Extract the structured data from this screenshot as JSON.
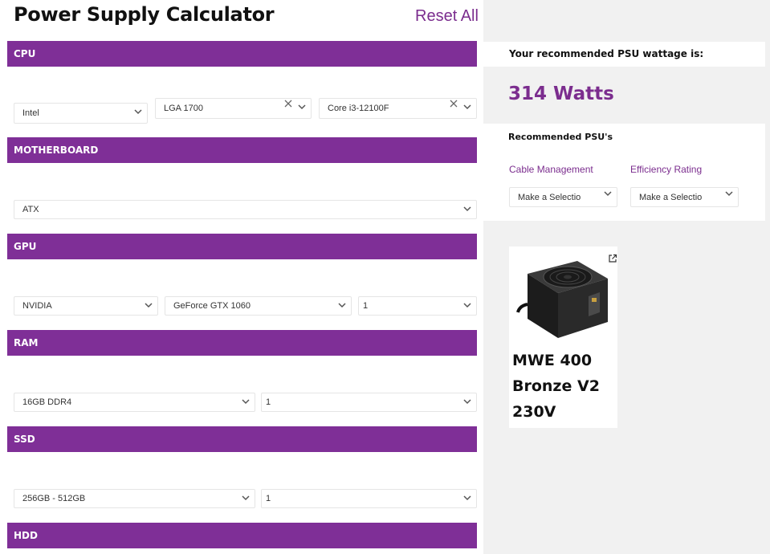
{
  "header": {
    "title": "Power Supply Calculator",
    "reset_label": "Reset All"
  },
  "sections": {
    "cpu": {
      "label": "CPU",
      "brand": "Intel",
      "socket": "LGA 1700",
      "model": "Core i3-12100F"
    },
    "motherboard": {
      "label": "MOTHERBOARD",
      "form_factor": "ATX"
    },
    "gpu": {
      "label": "GPU",
      "brand": "NVIDIA",
      "model": "GeForce GTX 1060",
      "quantity": "1"
    },
    "ram": {
      "label": "RAM",
      "size": "16GB DDR4",
      "quantity": "1"
    },
    "ssd": {
      "label": "SSD",
      "size": "256GB - 512GB",
      "quantity": "1"
    },
    "hdd": {
      "label": "HDD"
    }
  },
  "result": {
    "heading": "Your recommended PSU wattage is:",
    "wattage": "314 Watts",
    "recommended_title": "Recommended PSU's",
    "filters": [
      {
        "label": "Cable Management",
        "value": "Make a Selectio"
      },
      {
        "label": "Efficiency Rating",
        "value": "Make a Selectio"
      }
    ],
    "products": [
      {
        "name": "MWE 400 Bronze V2 230V"
      }
    ]
  },
  "colors": {
    "accent": "#7f2f97",
    "panel_bg": "#f1f1f1"
  }
}
